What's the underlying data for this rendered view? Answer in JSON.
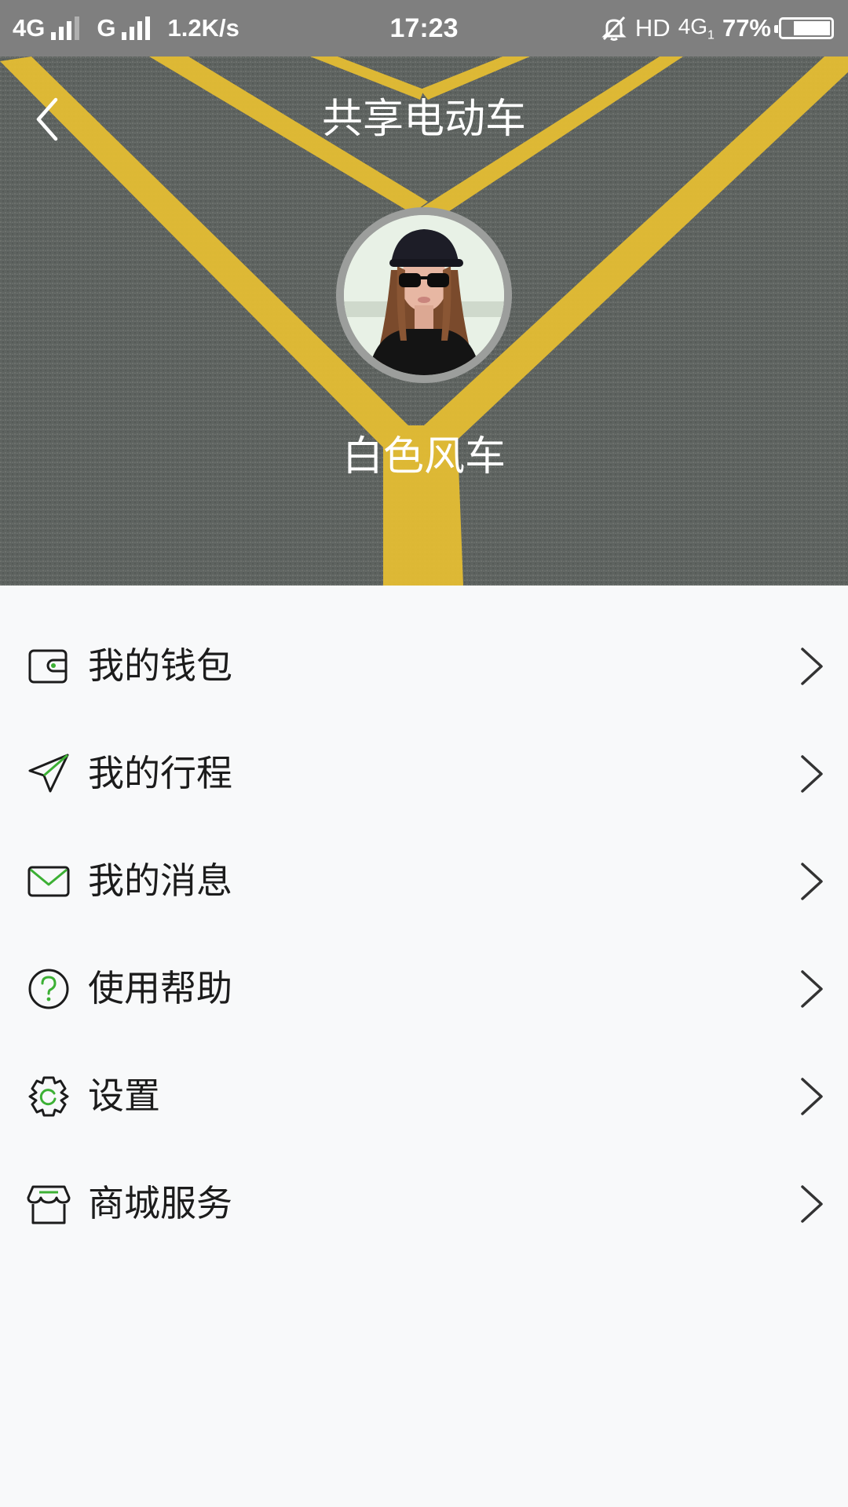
{
  "status_bar": {
    "network_1": "4G",
    "network_2": "G",
    "speed": "1.2K/s",
    "time": "17:23",
    "hd": "HD",
    "network_3": "4G",
    "network_3_sub": "1",
    "battery": "77%",
    "battery_level": 0.77
  },
  "header": {
    "title": "共享电动车",
    "back_icon": "chevron-left-icon",
    "avatar_icon": "avatar",
    "username": "白色风车"
  },
  "menu": {
    "items": [
      {
        "label": "我的钱包",
        "icon": "wallet-icon"
      },
      {
        "label": "我的行程",
        "icon": "paper-plane-icon"
      },
      {
        "label": "我的消息",
        "icon": "envelope-icon"
      },
      {
        "label": "使用帮助",
        "icon": "help-circle-icon"
      },
      {
        "label": "设置",
        "icon": "gear-icon"
      },
      {
        "label": "商城服务",
        "icon": "store-icon"
      }
    ]
  },
  "colors": {
    "accent_green": "#3cb034",
    "road_yellow": "#e8bf2e",
    "asphalt": "#5d625f"
  }
}
